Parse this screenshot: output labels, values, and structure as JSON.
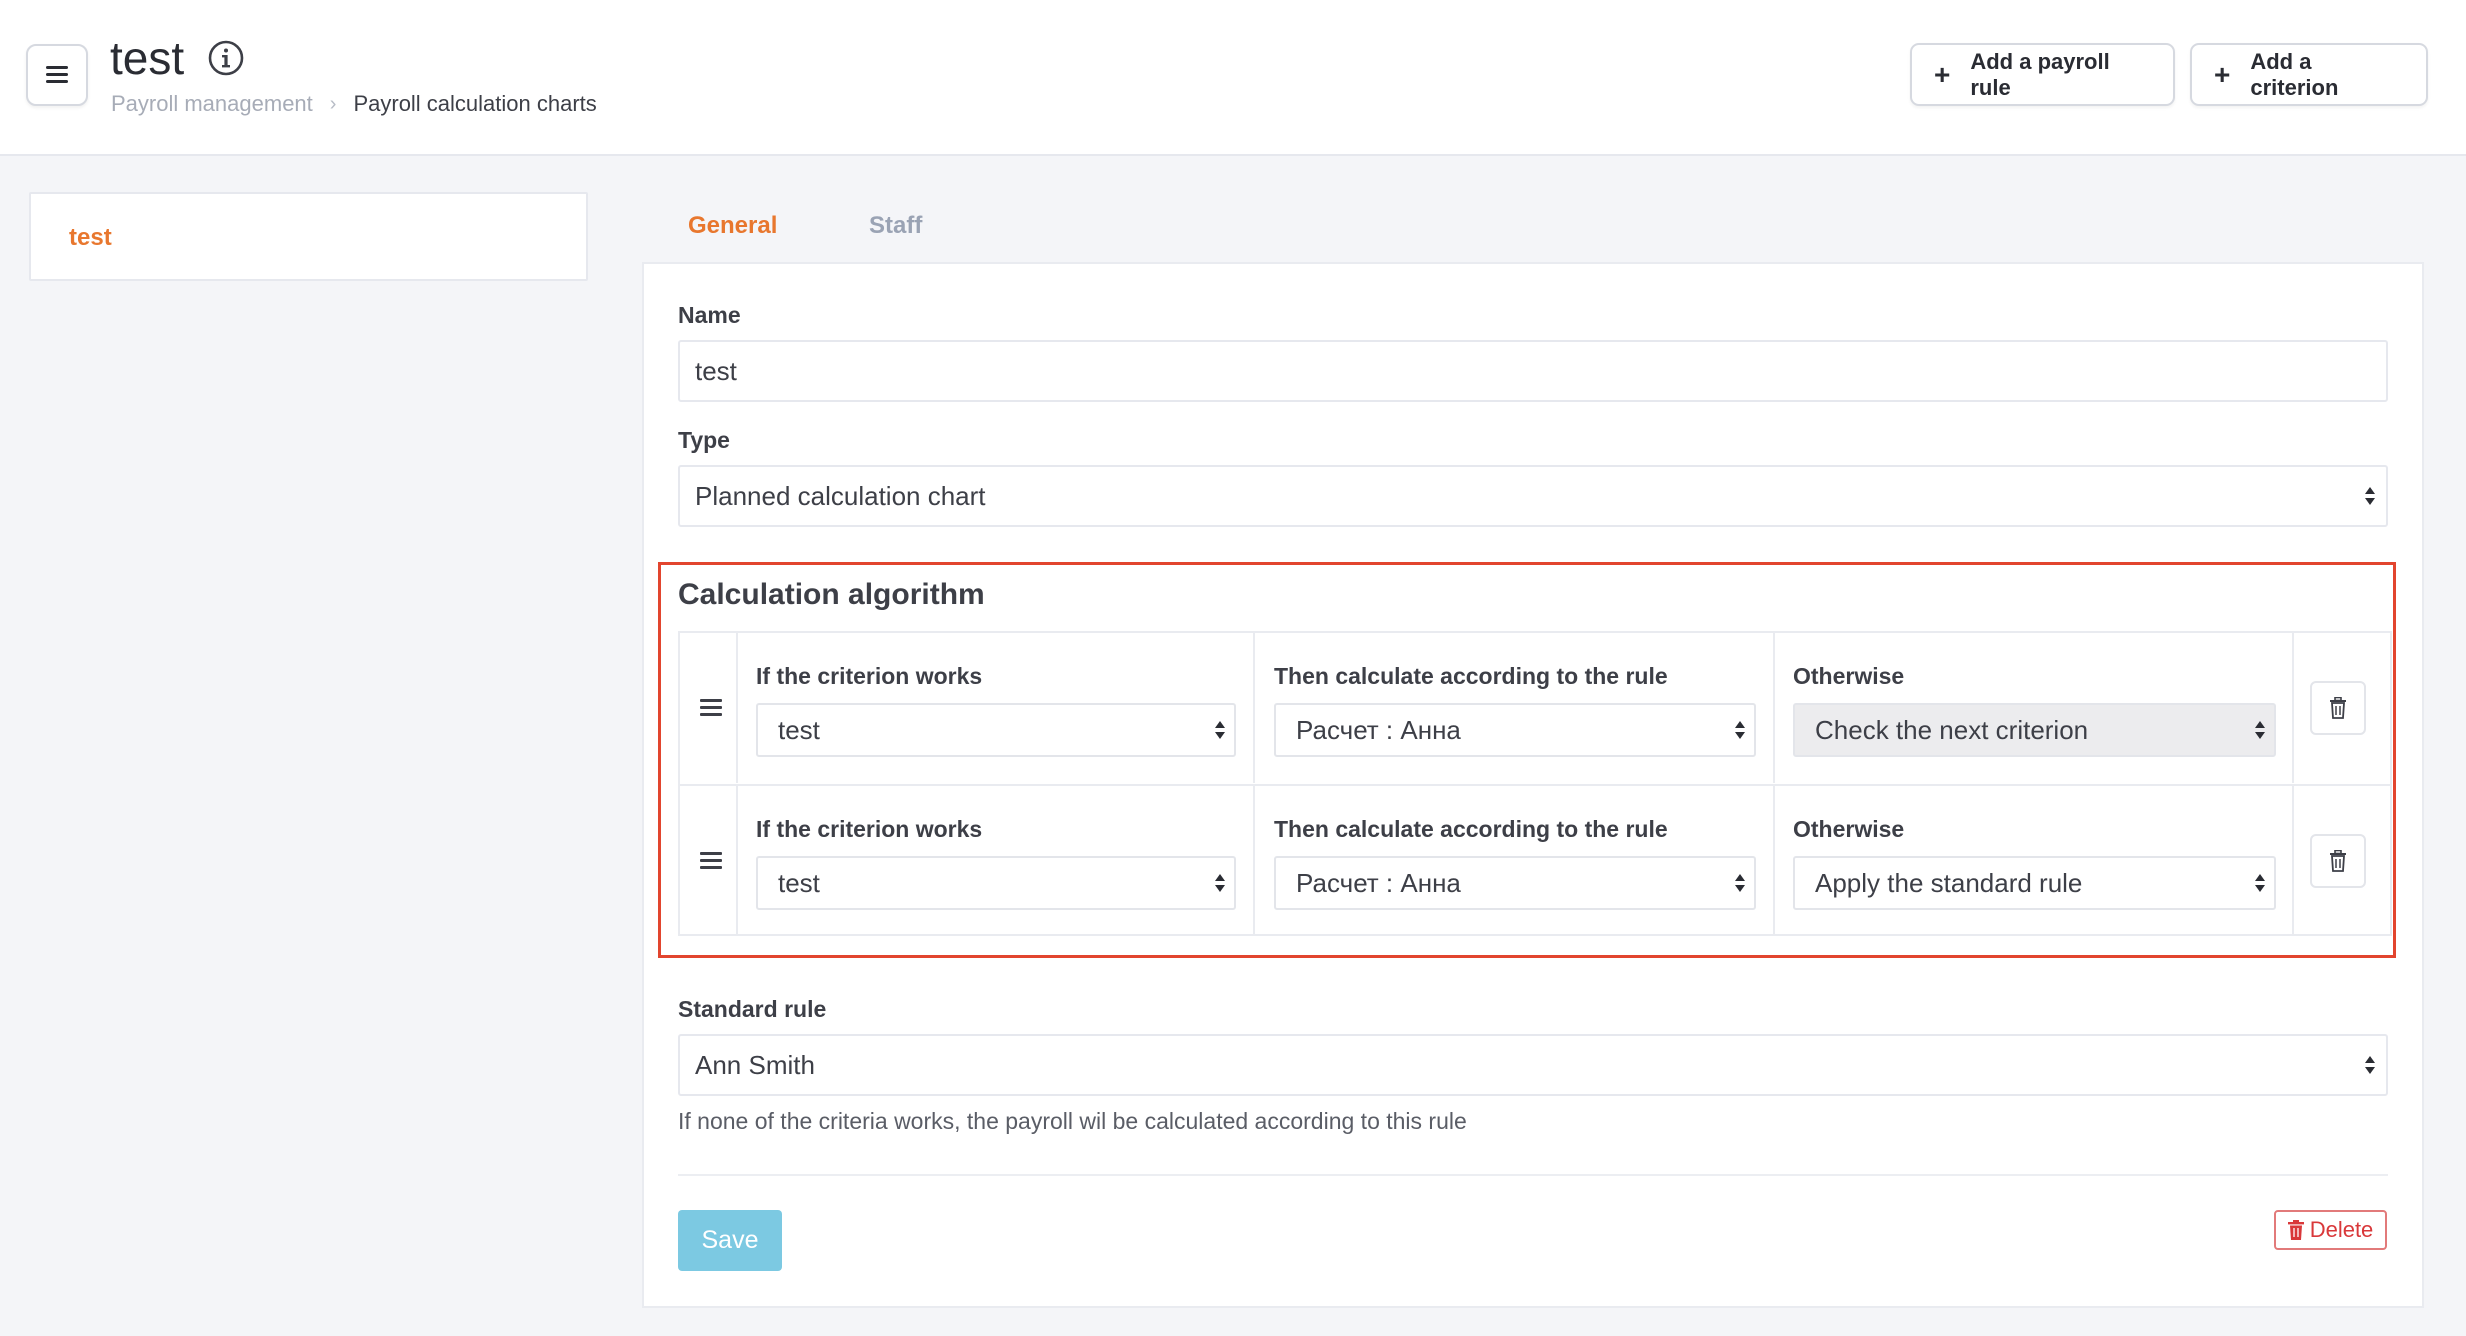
{
  "header": {
    "title": "test",
    "breadcrumb": [
      "Payroll management",
      "Payroll calculation charts"
    ],
    "buttons": {
      "add_payroll_rule": "Add a payroll rule",
      "add_criterion": "Add a criterion"
    }
  },
  "sidebar": {
    "items": [
      {
        "label": "test",
        "active": true
      }
    ]
  },
  "tabs": [
    {
      "label": "General",
      "active": true
    },
    {
      "label": "Staff",
      "active": false
    }
  ],
  "form": {
    "name_label": "Name",
    "name_value": "test",
    "type_label": "Type",
    "type_value": "Planned calculation chart",
    "algorithm": {
      "title": "Calculation algorithm",
      "rows": [
        {
          "criterion_label": "If the criterion works",
          "criterion_value": "test",
          "rule_label": "Then calculate according to the rule",
          "rule_value": "Расчет : Анна",
          "otherwise_label": "Otherwise",
          "otherwise_value": "Check the next criterion"
        },
        {
          "criterion_label": "If the criterion works",
          "criterion_value": "test",
          "rule_label": "Then calculate according to the rule",
          "rule_value": "Расчет : Анна",
          "otherwise_label": "Otherwise",
          "otherwise_value": "Apply the standard rule"
        }
      ]
    },
    "standard_rule_label": "Standard rule",
    "standard_rule_value": "Ann Smith",
    "standard_rule_hint": "If none of the criteria works, the payroll wil be calculated according to this rule",
    "save_label": "Save",
    "delete_label": "Delete"
  },
  "colors": {
    "accent": "#e8772e",
    "highlight_border": "#e2452e",
    "save_button": "#7cc9e2",
    "delete": "#d9383a"
  }
}
